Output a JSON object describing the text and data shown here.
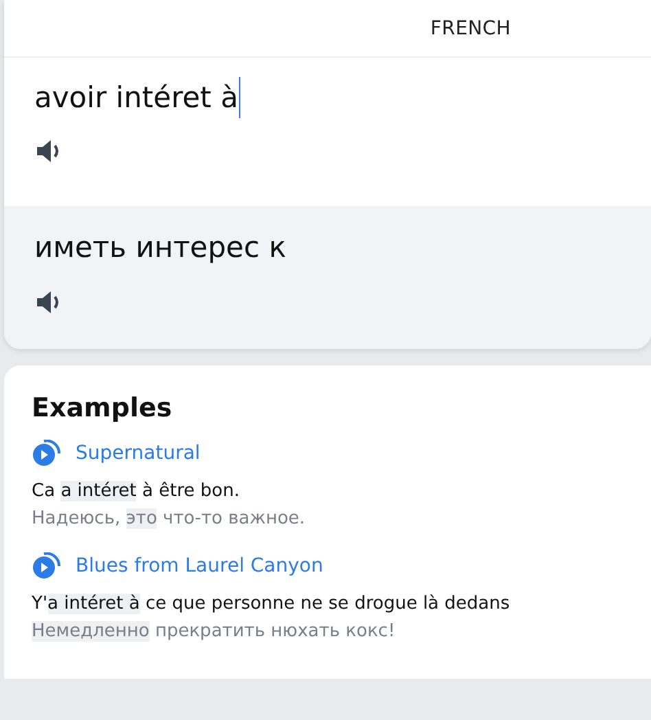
{
  "header": {
    "target_language": "FRENCH"
  },
  "source": {
    "value": "avoir intéret à"
  },
  "translation": {
    "text": "иметь интерес к"
  },
  "examples": {
    "title": "Examples",
    "items": [
      {
        "song": "Supernatural",
        "source": [
          {
            "text": "Ca ",
            "highlighted": false
          },
          {
            "text": "a intéret",
            "highlighted": true
          },
          {
            "text": " à être bon.",
            "highlighted": false
          }
        ],
        "translation": [
          {
            "text": "Надеюсь, ",
            "highlighted": false
          },
          {
            "text": "это",
            "highlighted": true
          },
          {
            "text": " что-то важное.",
            "highlighted": false
          }
        ]
      },
      {
        "song": "Blues from Laurel Canyon",
        "source": [
          {
            "text": "Y'",
            "highlighted": false
          },
          {
            "text": "a intéret à",
            "highlighted": true
          },
          {
            "text": " ce que personne ne se drogue là dedans",
            "highlighted": false
          }
        ],
        "translation": [
          {
            "text": "Немедленно",
            "highlighted": true
          },
          {
            "text": " прекратить нюхать кокс!",
            "highlighted": false
          }
        ]
      }
    ]
  }
}
